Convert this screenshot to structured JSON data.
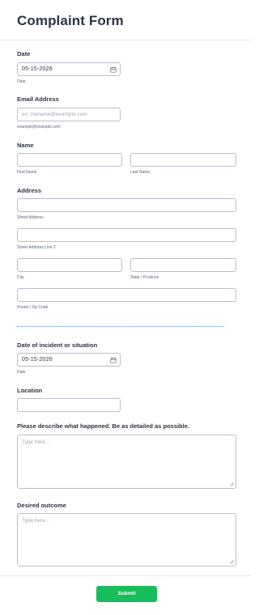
{
  "form": {
    "title": "Complaint Form",
    "date": {
      "label": "Date",
      "value": "05-15-2026",
      "sublabel": "Date"
    },
    "email": {
      "label": "Email Address",
      "placeholder": "ex: myname@example.com",
      "sublabel": "example@example.com"
    },
    "name": {
      "label": "Name",
      "first_sublabel": "First Name",
      "last_sublabel": "Last Name"
    },
    "address": {
      "label": "Address",
      "street_sublabel": "Street Address",
      "street2_sublabel": "Street Address Line 2",
      "city_sublabel": "City",
      "state_sublabel": "State / Province",
      "postal_sublabel": "Postal / Zip Code"
    },
    "incident_date": {
      "label": "Date of incident or situation",
      "value": "05-15-2026",
      "sublabel": "Date"
    },
    "location": {
      "label": "Location"
    },
    "description": {
      "label": "Please describe what happened. Be as detailed as possible.",
      "placeholder": "Type here..."
    },
    "outcome": {
      "label": "Desired outcome",
      "placeholder": "Type here..."
    },
    "submit_label": "Submit"
  },
  "colors": {
    "accent": "#18bd5b",
    "divider": "#4a90e2",
    "text": "#2c3345"
  }
}
